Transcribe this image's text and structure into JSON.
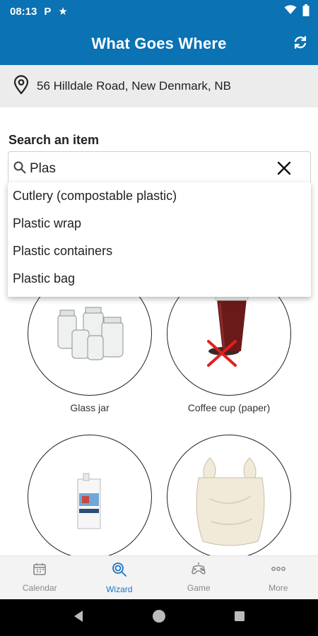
{
  "status_bar": {
    "time": "08:13",
    "indicators": [
      "parking-icon",
      "star-icon"
    ],
    "system_icons": [
      "wifi-icon",
      "battery-icon"
    ]
  },
  "app_bar": {
    "title": "What Goes Where",
    "refresh_icon": "refresh-icon"
  },
  "address": {
    "icon": "location-pin-icon",
    "text": "56 Hilldale Road, New Denmark, NB"
  },
  "search": {
    "label": "Search an item",
    "value": "Plas",
    "search_icon": "search-icon",
    "clear_icon": "close-icon"
  },
  "suggestions": [
    "Cutlery (compostable plastic)",
    "Plastic wrap",
    "Plastic containers",
    "Plastic bag"
  ],
  "items": [
    {
      "label": "Glass jar",
      "image": "glass-jars"
    },
    {
      "label": "Coffee cup (paper)",
      "image": "coffee-cup-with-red-x"
    },
    {
      "label": "",
      "image": "milk-carton"
    },
    {
      "label": "",
      "image": "plastic-bag"
    }
  ],
  "bottom_nav": [
    {
      "label": "Calendar",
      "icon": "calendar-icon",
      "active": false
    },
    {
      "label": "Wizard",
      "icon": "wizard-search-icon",
      "active": true
    },
    {
      "label": "Game",
      "icon": "game-controller-icon",
      "active": false
    },
    {
      "label": "More",
      "icon": "more-dots-icon",
      "active": false
    }
  ],
  "colors": {
    "primary": "#0b72b3",
    "active_nav": "#1a73c4",
    "address_bg": "#ececec",
    "x_mark": "#e0201e"
  },
  "system_nav": [
    "back-icon",
    "home-icon",
    "recents-icon"
  ]
}
